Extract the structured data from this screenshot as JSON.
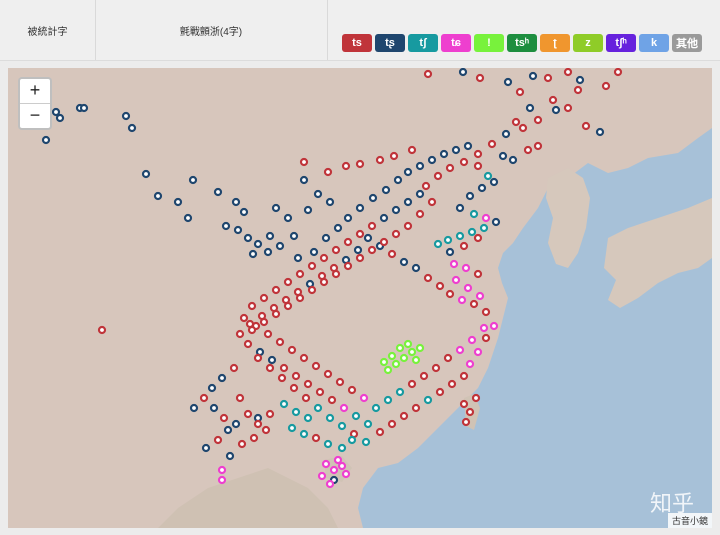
{
  "header": {
    "col1": "被統計字",
    "col2": "氈戰顫浙(4字)"
  },
  "legend": [
    {
      "label": "ts",
      "color": "#c0343a"
    },
    {
      "label": "tʂ",
      "color": "#1f466e"
    },
    {
      "label": "tʃ",
      "color": "#179aa0"
    },
    {
      "label": "tɕ",
      "color": "#ee3fcf"
    },
    {
      "label": "!",
      "color": "#78f23c"
    },
    {
      "label": "tsʰ",
      "color": "#1d8e3f"
    },
    {
      "label": "ʈ",
      "color": "#f0962e"
    },
    {
      "label": "z",
      "color": "#8fcc28"
    },
    {
      "label": "tʃʰ",
      "color": "#6622dd"
    },
    {
      "label": "k",
      "color": "#6fa3e6"
    },
    {
      "label": "其他",
      "color": "#9a9a9a"
    }
  ],
  "map": {
    "zoom_in": "+",
    "zoom_out": "−",
    "watermark": "知乎",
    "credit": "古音小鏡",
    "dots": [
      [
        420,
        6,
        "#c0343a"
      ],
      [
        455,
        4,
        "#1f466e"
      ],
      [
        472,
        10,
        "#c0343a"
      ],
      [
        500,
        14,
        "#1f466e"
      ],
      [
        512,
        24,
        "#c0343a"
      ],
      [
        525,
        8,
        "#1f466e"
      ],
      [
        540,
        10,
        "#c0343a"
      ],
      [
        560,
        4,
        "#c0343a"
      ],
      [
        572,
        12,
        "#1f466e"
      ],
      [
        598,
        18,
        "#c0343a"
      ],
      [
        610,
        4,
        "#c0343a"
      ],
      [
        570,
        22,
        "#c0343a"
      ],
      [
        545,
        32,
        "#c0343a"
      ],
      [
        522,
        40,
        "#1f466e"
      ],
      [
        508,
        54,
        "#c0343a"
      ],
      [
        498,
        66,
        "#1f466e"
      ],
      [
        515,
        60,
        "#c0343a"
      ],
      [
        530,
        52,
        "#c0343a"
      ],
      [
        548,
        42,
        "#1f466e"
      ],
      [
        560,
        40,
        "#c0343a"
      ],
      [
        578,
        58,
        "#c0343a"
      ],
      [
        592,
        64,
        "#1f466e"
      ],
      [
        484,
        76,
        "#c0343a"
      ],
      [
        470,
        86,
        "#c0343a"
      ],
      [
        495,
        88,
        "#1f466e"
      ],
      [
        520,
        82,
        "#c0343a"
      ],
      [
        530,
        78,
        "#c0343a"
      ],
      [
        505,
        92,
        "#1f466e"
      ],
      [
        48,
        44,
        "#1f466e"
      ],
      [
        52,
        50,
        "#1f466e"
      ],
      [
        72,
        40,
        "#1f466e"
      ],
      [
        76,
        40,
        "#1f466e"
      ],
      [
        118,
        48,
        "#1f466e"
      ],
      [
        124,
        60,
        "#1f466e"
      ],
      [
        38,
        72,
        "#1f466e"
      ],
      [
        138,
        106,
        "#1f466e"
      ],
      [
        185,
        112,
        "#1f466e"
      ],
      [
        210,
        124,
        "#1f466e"
      ],
      [
        228,
        134,
        "#1f466e"
      ],
      [
        236,
        144,
        "#1f466e"
      ],
      [
        218,
        158,
        "#1f466e"
      ],
      [
        230,
        162,
        "#1f466e"
      ],
      [
        240,
        170,
        "#1f466e"
      ],
      [
        250,
        176,
        "#1f466e"
      ],
      [
        262,
        168,
        "#1f466e"
      ],
      [
        260,
        184,
        "#1f466e"
      ],
      [
        245,
        186,
        "#1f466e"
      ],
      [
        272,
        178,
        "#1f466e"
      ],
      [
        286,
        168,
        "#1f466e"
      ],
      [
        296,
        112,
        "#1f466e"
      ],
      [
        310,
        126,
        "#1f466e"
      ],
      [
        322,
        134,
        "#1f466e"
      ],
      [
        280,
        150,
        "#1f466e"
      ],
      [
        268,
        140,
        "#1f466e"
      ],
      [
        300,
        142,
        "#1f466e"
      ],
      [
        290,
        190,
        "#1f466e"
      ],
      [
        306,
        184,
        "#1f466e"
      ],
      [
        318,
        170,
        "#1f466e"
      ],
      [
        330,
        160,
        "#1f466e"
      ],
      [
        340,
        150,
        "#1f466e"
      ],
      [
        352,
        140,
        "#1f466e"
      ],
      [
        365,
        130,
        "#1f466e"
      ],
      [
        378,
        122,
        "#1f466e"
      ],
      [
        390,
        112,
        "#1f466e"
      ],
      [
        400,
        104,
        "#1f466e"
      ],
      [
        412,
        98,
        "#1f466e"
      ],
      [
        424,
        92,
        "#1f466e"
      ],
      [
        436,
        86,
        "#1f466e"
      ],
      [
        448,
        82,
        "#1f466e"
      ],
      [
        460,
        78,
        "#1f466e"
      ],
      [
        296,
        94,
        "#c0343a"
      ],
      [
        320,
        104,
        "#c0343a"
      ],
      [
        338,
        98,
        "#c0343a"
      ],
      [
        352,
        96,
        "#c0343a"
      ],
      [
        372,
        92,
        "#c0343a"
      ],
      [
        386,
        88,
        "#c0343a"
      ],
      [
        404,
        82,
        "#c0343a"
      ],
      [
        418,
        118,
        "#c0343a"
      ],
      [
        430,
        108,
        "#c0343a"
      ],
      [
        442,
        100,
        "#c0343a"
      ],
      [
        456,
        94,
        "#c0343a"
      ],
      [
        470,
        98,
        "#c0343a"
      ],
      [
        480,
        108,
        "#179aa0"
      ],
      [
        486,
        114,
        "#1f466e"
      ],
      [
        474,
        120,
        "#1f466e"
      ],
      [
        462,
        128,
        "#1f466e"
      ],
      [
        452,
        140,
        "#1f466e"
      ],
      [
        466,
        146,
        "#179aa0"
      ],
      [
        478,
        150,
        "#ee3fcf"
      ],
      [
        488,
        154,
        "#1f466e"
      ],
      [
        476,
        160,
        "#179aa0"
      ],
      [
        464,
        164,
        "#179aa0"
      ],
      [
        452,
        168,
        "#179aa0"
      ],
      [
        440,
        172,
        "#179aa0"
      ],
      [
        430,
        176,
        "#179aa0"
      ],
      [
        442,
        184,
        "#1f466e"
      ],
      [
        456,
        178,
        "#c0343a"
      ],
      [
        470,
        170,
        "#c0343a"
      ],
      [
        446,
        196,
        "#ee3fcf"
      ],
      [
        458,
        200,
        "#ee3fcf"
      ],
      [
        470,
        206,
        "#c0343a"
      ],
      [
        448,
        212,
        "#ee3fcf"
      ],
      [
        460,
        220,
        "#ee3fcf"
      ],
      [
        472,
        228,
        "#ee3fcf"
      ],
      [
        466,
        236,
        "#c0343a"
      ],
      [
        478,
        244,
        "#c0343a"
      ],
      [
        454,
        232,
        "#ee3fcf"
      ],
      [
        442,
        226,
        "#c0343a"
      ],
      [
        432,
        218,
        "#c0343a"
      ],
      [
        420,
        210,
        "#c0343a"
      ],
      [
        408,
        200,
        "#1f466e"
      ],
      [
        396,
        194,
        "#1f466e"
      ],
      [
        384,
        186,
        "#c0343a"
      ],
      [
        372,
        178,
        "#1f466e"
      ],
      [
        360,
        170,
        "#1f466e"
      ],
      [
        350,
        182,
        "#1f466e"
      ],
      [
        338,
        192,
        "#1f466e"
      ],
      [
        326,
        200,
        "#c0343a"
      ],
      [
        314,
        208,
        "#c0343a"
      ],
      [
        302,
        216,
        "#1f466e"
      ],
      [
        290,
        224,
        "#c0343a"
      ],
      [
        278,
        232,
        "#c0343a"
      ],
      [
        266,
        240,
        "#c0343a"
      ],
      [
        254,
        248,
        "#c0343a"
      ],
      [
        242,
        256,
        "#c0343a"
      ],
      [
        232,
        266,
        "#c0343a"
      ],
      [
        240,
        276,
        "#c0343a"
      ],
      [
        252,
        284,
        "#1f466e"
      ],
      [
        264,
        292,
        "#1f466e"
      ],
      [
        276,
        300,
        "#c0343a"
      ],
      [
        288,
        308,
        "#c0343a"
      ],
      [
        300,
        316,
        "#c0343a"
      ],
      [
        312,
        324,
        "#c0343a"
      ],
      [
        324,
        332,
        "#c0343a"
      ],
      [
        336,
        340,
        "#ee3fcf"
      ],
      [
        348,
        348,
        "#179aa0"
      ],
      [
        360,
        356,
        "#179aa0"
      ],
      [
        372,
        364,
        "#c0343a"
      ],
      [
        384,
        356,
        "#c0343a"
      ],
      [
        396,
        348,
        "#c0343a"
      ],
      [
        408,
        340,
        "#c0343a"
      ],
      [
        420,
        332,
        "#179aa0"
      ],
      [
        432,
        324,
        "#c0343a"
      ],
      [
        444,
        316,
        "#c0343a"
      ],
      [
        456,
        308,
        "#c0343a"
      ],
      [
        462,
        296,
        "#ee3fcf"
      ],
      [
        470,
        284,
        "#ee3fcf"
      ],
      [
        478,
        270,
        "#c0343a"
      ],
      [
        486,
        258,
        "#ee3fcf"
      ],
      [
        476,
        260,
        "#ee3fcf"
      ],
      [
        464,
        272,
        "#ee3fcf"
      ],
      [
        452,
        282,
        "#ee3fcf"
      ],
      [
        440,
        290,
        "#c0343a"
      ],
      [
        428,
        300,
        "#c0343a"
      ],
      [
        416,
        308,
        "#c0343a"
      ],
      [
        404,
        316,
        "#c0343a"
      ],
      [
        392,
        324,
        "#179aa0"
      ],
      [
        380,
        332,
        "#179aa0"
      ],
      [
        368,
        340,
        "#179aa0"
      ],
      [
        356,
        330,
        "#ee3fcf"
      ],
      [
        344,
        322,
        "#c0343a"
      ],
      [
        332,
        314,
        "#c0343a"
      ],
      [
        320,
        306,
        "#c0343a"
      ],
      [
        308,
        298,
        "#c0343a"
      ],
      [
        296,
        290,
        "#c0343a"
      ],
      [
        284,
        282,
        "#c0343a"
      ],
      [
        272,
        274,
        "#c0343a"
      ],
      [
        260,
        266,
        "#c0343a"
      ],
      [
        248,
        258,
        "#c0343a"
      ],
      [
        236,
        250,
        "#c0343a"
      ],
      [
        244,
        238,
        "#c0343a"
      ],
      [
        256,
        230,
        "#c0343a"
      ],
      [
        268,
        222,
        "#c0343a"
      ],
      [
        280,
        214,
        "#c0343a"
      ],
      [
        292,
        206,
        "#c0343a"
      ],
      [
        304,
        198,
        "#c0343a"
      ],
      [
        316,
        190,
        "#c0343a"
      ],
      [
        328,
        182,
        "#c0343a"
      ],
      [
        340,
        174,
        "#c0343a"
      ],
      [
        352,
        166,
        "#c0343a"
      ],
      [
        364,
        158,
        "#c0343a"
      ],
      [
        376,
        150,
        "#1f466e"
      ],
      [
        388,
        142,
        "#1f466e"
      ],
      [
        400,
        134,
        "#1f466e"
      ],
      [
        412,
        126,
        "#1f466e"
      ],
      [
        424,
        134,
        "#c0343a"
      ],
      [
        412,
        146,
        "#c0343a"
      ],
      [
        400,
        158,
        "#c0343a"
      ],
      [
        388,
        166,
        "#c0343a"
      ],
      [
        376,
        174,
        "#c0343a"
      ],
      [
        364,
        182,
        "#c0343a"
      ],
      [
        352,
        190,
        "#c0343a"
      ],
      [
        340,
        198,
        "#c0343a"
      ],
      [
        328,
        206,
        "#c0343a"
      ],
      [
        316,
        214,
        "#c0343a"
      ],
      [
        304,
        222,
        "#c0343a"
      ],
      [
        292,
        230,
        "#c0343a"
      ],
      [
        280,
        238,
        "#c0343a"
      ],
      [
        268,
        246,
        "#c0343a"
      ],
      [
        256,
        254,
        "#c0343a"
      ],
      [
        244,
        262,
        "#c0343a"
      ],
      [
        250,
        290,
        "#c0343a"
      ],
      [
        262,
        300,
        "#c0343a"
      ],
      [
        274,
        310,
        "#c0343a"
      ],
      [
        286,
        320,
        "#c0343a"
      ],
      [
        298,
        330,
        "#c0343a"
      ],
      [
        310,
        340,
        "#179aa0"
      ],
      [
        322,
        350,
        "#179aa0"
      ],
      [
        334,
        358,
        "#179aa0"
      ],
      [
        346,
        366,
        "#c0343a"
      ],
      [
        358,
        374,
        "#179aa0"
      ],
      [
        300,
        350,
        "#179aa0"
      ],
      [
        288,
        344,
        "#179aa0"
      ],
      [
        276,
        336,
        "#179aa0"
      ],
      [
        284,
        360,
        "#179aa0"
      ],
      [
        296,
        366,
        "#179aa0"
      ],
      [
        308,
        370,
        "#c0343a"
      ],
      [
        320,
        376,
        "#179aa0"
      ],
      [
        334,
        380,
        "#179aa0"
      ],
      [
        344,
        372,
        "#179aa0"
      ],
      [
        380,
        302,
        "#78f23c"
      ],
      [
        388,
        296,
        "#78f23c"
      ],
      [
        396,
        290,
        "#78f23c"
      ],
      [
        404,
        284,
        "#78f23c"
      ],
      [
        392,
        280,
        "#78f23c"
      ],
      [
        400,
        276,
        "#78f23c"
      ],
      [
        384,
        288,
        "#78f23c"
      ],
      [
        408,
        292,
        "#78f23c"
      ],
      [
        412,
        280,
        "#78f23c"
      ],
      [
        376,
        294,
        "#78f23c"
      ],
      [
        226,
        300,
        "#c0343a"
      ],
      [
        214,
        310,
        "#1f466e"
      ],
      [
        204,
        320,
        "#1f466e"
      ],
      [
        196,
        330,
        "#c0343a"
      ],
      [
        186,
        340,
        "#1f466e"
      ],
      [
        206,
        340,
        "#1f466e"
      ],
      [
        216,
        350,
        "#c0343a"
      ],
      [
        228,
        356,
        "#1f466e"
      ],
      [
        240,
        346,
        "#c0343a"
      ],
      [
        232,
        330,
        "#c0343a"
      ],
      [
        220,
        362,
        "#1f466e"
      ],
      [
        210,
        372,
        "#c0343a"
      ],
      [
        198,
        380,
        "#1f466e"
      ],
      [
        222,
        388,
        "#1f466e"
      ],
      [
        234,
        376,
        "#c0343a"
      ],
      [
        246,
        370,
        "#c0343a"
      ],
      [
        258,
        362,
        "#c0343a"
      ],
      [
        250,
        350,
        "#1f466e"
      ],
      [
        214,
        402,
        "#ee3fcf"
      ],
      [
        214,
        412,
        "#ee3fcf"
      ],
      [
        250,
        356,
        "#c0343a"
      ],
      [
        262,
        346,
        "#c0343a"
      ],
      [
        318,
        396,
        "#ee3fcf"
      ],
      [
        326,
        402,
        "#ee3fcf"
      ],
      [
        334,
        398,
        "#ee3fcf"
      ],
      [
        314,
        408,
        "#ee3fcf"
      ],
      [
        326,
        412,
        "#1f466e"
      ],
      [
        338,
        406,
        "#ee3fcf"
      ],
      [
        330,
        392,
        "#ee3fcf"
      ],
      [
        322,
        416,
        "#ee3fcf"
      ],
      [
        456,
        336,
        "#c0343a"
      ],
      [
        462,
        344,
        "#c0343a"
      ],
      [
        468,
        330,
        "#c0343a"
      ],
      [
        458,
        354,
        "#c0343a"
      ],
      [
        94,
        262,
        "#c0343a"
      ],
      [
        150,
        128,
        "#1f466e"
      ],
      [
        170,
        134,
        "#1f466e"
      ],
      [
        180,
        150,
        "#1f466e"
      ]
    ]
  }
}
